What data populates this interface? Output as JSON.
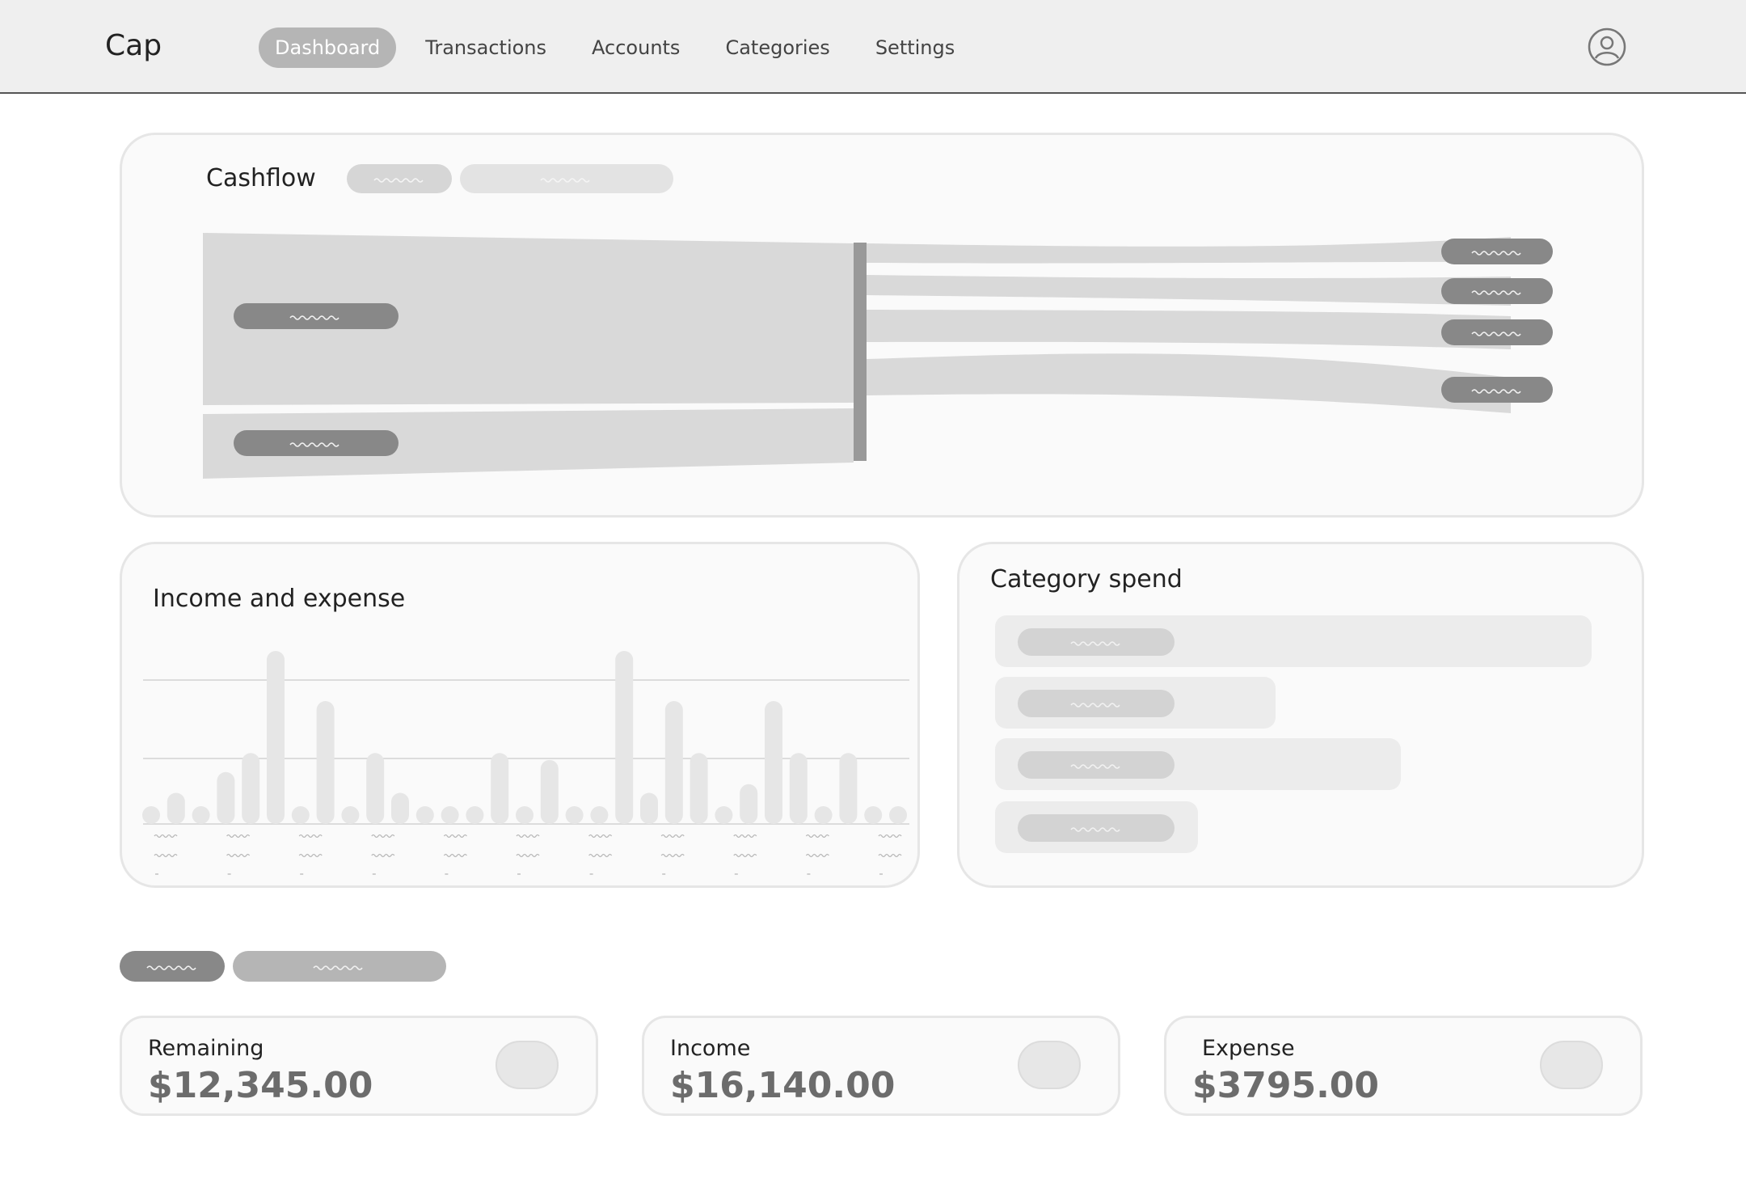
{
  "header": {
    "app_name": "Cap",
    "nav": [
      "Dashboard",
      "Transactions",
      "Accounts",
      "Categories",
      "Settings"
    ],
    "active_nav": "Dashboard",
    "user_icon": "user-circle-icon"
  },
  "cashflow": {
    "title": "Cashflow"
  },
  "income_expense": {
    "title": "Income and expense",
    "bar_levels": [
      0.06,
      0.18,
      0.06,
      0.3,
      0.41,
      1.0,
      0.06,
      0.71,
      0.06,
      0.41,
      0.18,
      0.06,
      0.06,
      0.06,
      0.41,
      0.06,
      0.37,
      0.06,
      0.06,
      1.0,
      0.18,
      0.71,
      0.41,
      0.06,
      0.23,
      0.71,
      0.41,
      0.06,
      0.41,
      0.06,
      0.06
    ]
  },
  "category_spend": {
    "title": "Category spend",
    "bar_levels": [
      1.0,
      0.47,
      0.68,
      0.34
    ]
  },
  "summary": {
    "remaining_label": "Remaining",
    "remaining_value": "$12,345.00",
    "income_label": "Income",
    "income_value": "$16,140.00",
    "expense_label": "Expense",
    "expense_value": "$3795.00"
  },
  "colors": {
    "header_bg": "#efefef",
    "active_pill": "#b5b5b5",
    "flow": "#d9d9d9",
    "node": "#999999",
    "label_pill": "#888888",
    "value_text": "#6c6c6c"
  }
}
